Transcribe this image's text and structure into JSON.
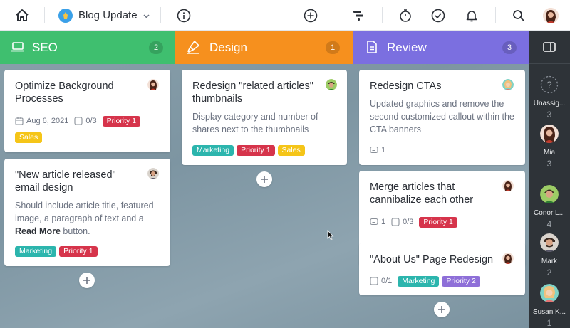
{
  "topbar": {
    "project_title": "Blog Update",
    "icons": [
      "home-icon",
      "chevron-down-icon",
      "info-icon",
      "add-icon",
      "timeline-icon",
      "stopwatch-icon",
      "check-icon",
      "bell-icon",
      "search-icon",
      "avatar"
    ]
  },
  "columns": [
    {
      "title": "SEO",
      "count": "2",
      "color": "#3fbf6f",
      "icon": "laptop-icon",
      "cards": [
        {
          "title": "Optimize Background Processes",
          "date": "Aug 6, 2021",
          "checklist": "0/3",
          "tags": [
            {
              "label": "Priority 1",
              "color": "#d6344b"
            },
            {
              "label": "Sales",
              "color": "#f5c518"
            }
          ]
        },
        {
          "title": "\"New article released\" email design",
          "description_prefix": "Should include article title, featured image, a paragraph of text and a ",
          "description_bold": "Read More",
          "description_suffix": " button.",
          "tags": [
            {
              "label": "Marketing",
              "color": "#2cb5ad"
            },
            {
              "label": "Priority 1",
              "color": "#d6344b"
            }
          ]
        }
      ]
    },
    {
      "title": "Design",
      "count": "1",
      "color": "#f6901e",
      "icon": "brush-icon",
      "cards": [
        {
          "title": "Redesign \"related articles\" thumbnails",
          "description": "Display category and number of shares next to the thumbnails",
          "tags": [
            {
              "label": "Marketing",
              "color": "#2cb5ad"
            },
            {
              "label": "Priority 1",
              "color": "#d6344b"
            },
            {
              "label": "Sales",
              "color": "#f5c518"
            }
          ]
        }
      ]
    },
    {
      "title": "Review",
      "count": "3",
      "color": "#7b6fe0",
      "icon": "document-icon",
      "cards": [
        {
          "title": "Redesign CTAs",
          "description": "Updated graphics and remove the second customized callout within the CTA banners",
          "comments": "1"
        },
        {
          "title": "Merge articles that cannibalize each other",
          "comments": "1",
          "checklist": "0/3",
          "tags": [
            {
              "label": "Priority 1",
              "color": "#d6344b"
            }
          ]
        },
        {
          "title": "\"About Us\" Page Redesign",
          "checklist": "0/1",
          "tags": [
            {
              "label": "Marketing",
              "color": "#2cb5ad"
            },
            {
              "label": "Priority 2",
              "color": "#8e6fd8"
            }
          ]
        }
      ]
    }
  ],
  "assignees": [
    {
      "name": "Unassig...",
      "count": "3"
    },
    {
      "name": "Mia",
      "count": "3"
    },
    {
      "name": "Conor L...",
      "count": "4"
    },
    {
      "name": "Mark",
      "count": "2"
    },
    {
      "name": "Susan K...",
      "count": "1"
    }
  ]
}
